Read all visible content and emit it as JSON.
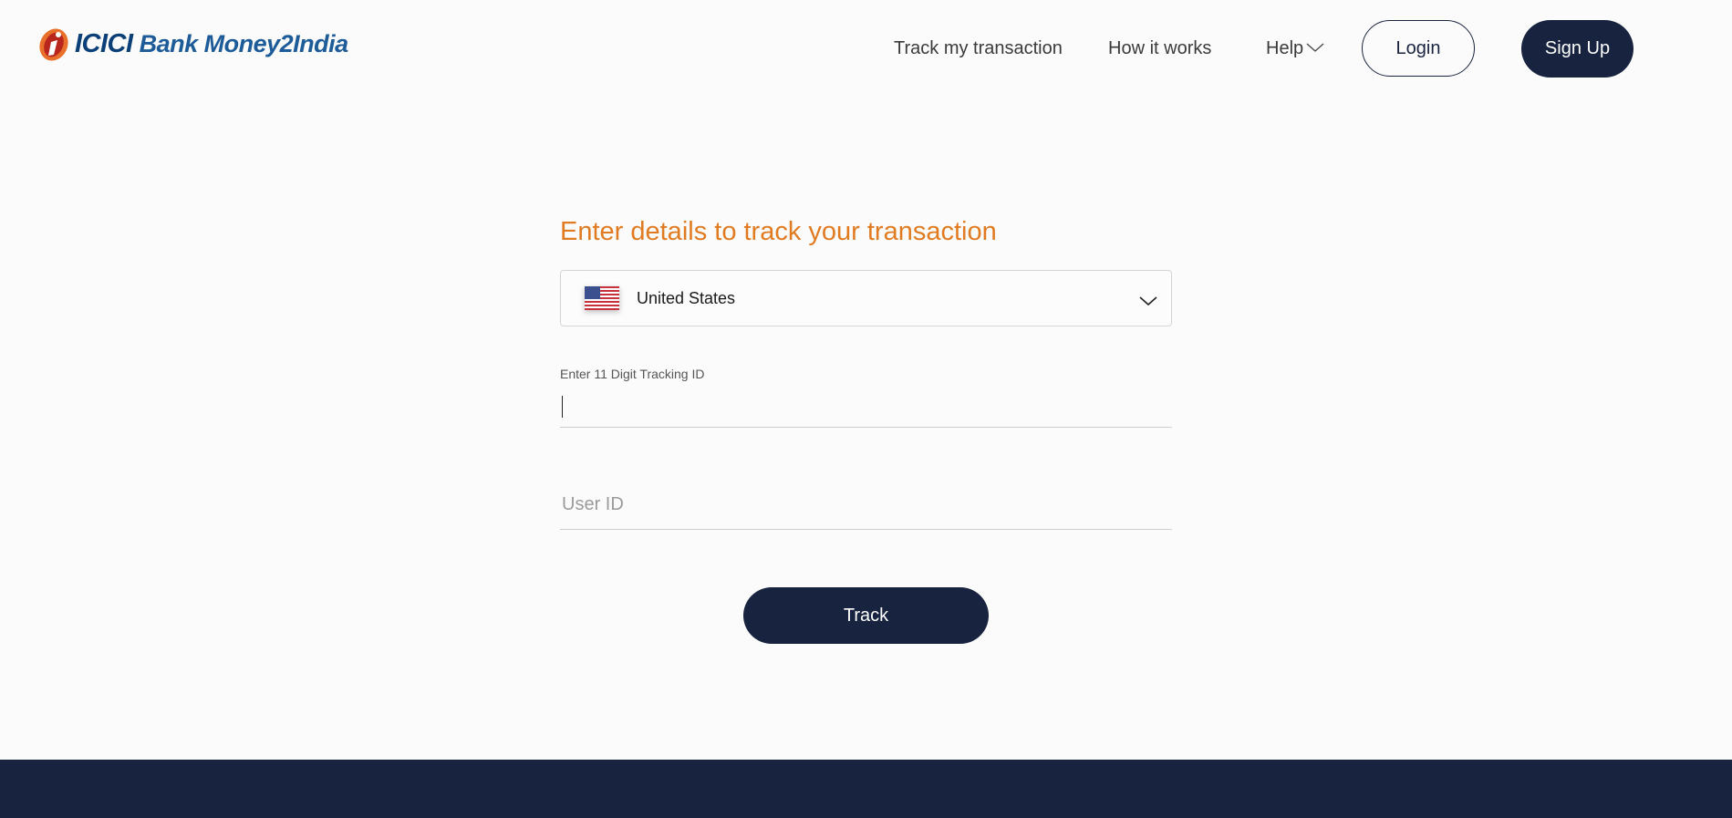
{
  "header": {
    "logo": {
      "brand": "ICICI",
      "rest": " Bank Money2India"
    },
    "nav": {
      "track": "Track my transaction",
      "how": "How it works",
      "help": "Help"
    },
    "login_label": "Login",
    "signup_label": "Sign Up"
  },
  "form": {
    "title": "Enter details to track your transaction",
    "country": {
      "selected": "United States",
      "flag_icon": "us-flag-icon"
    },
    "tracking": {
      "label": "Enter 11 Digit Tracking ID",
      "value": ""
    },
    "user_id": {
      "placeholder": "User ID",
      "value": ""
    },
    "track_label": "Track"
  },
  "colors": {
    "accent": "#e07b22",
    "navy": "#18233f",
    "brand_blue": "#0b4a86",
    "logo_orange": "#e8702a"
  }
}
